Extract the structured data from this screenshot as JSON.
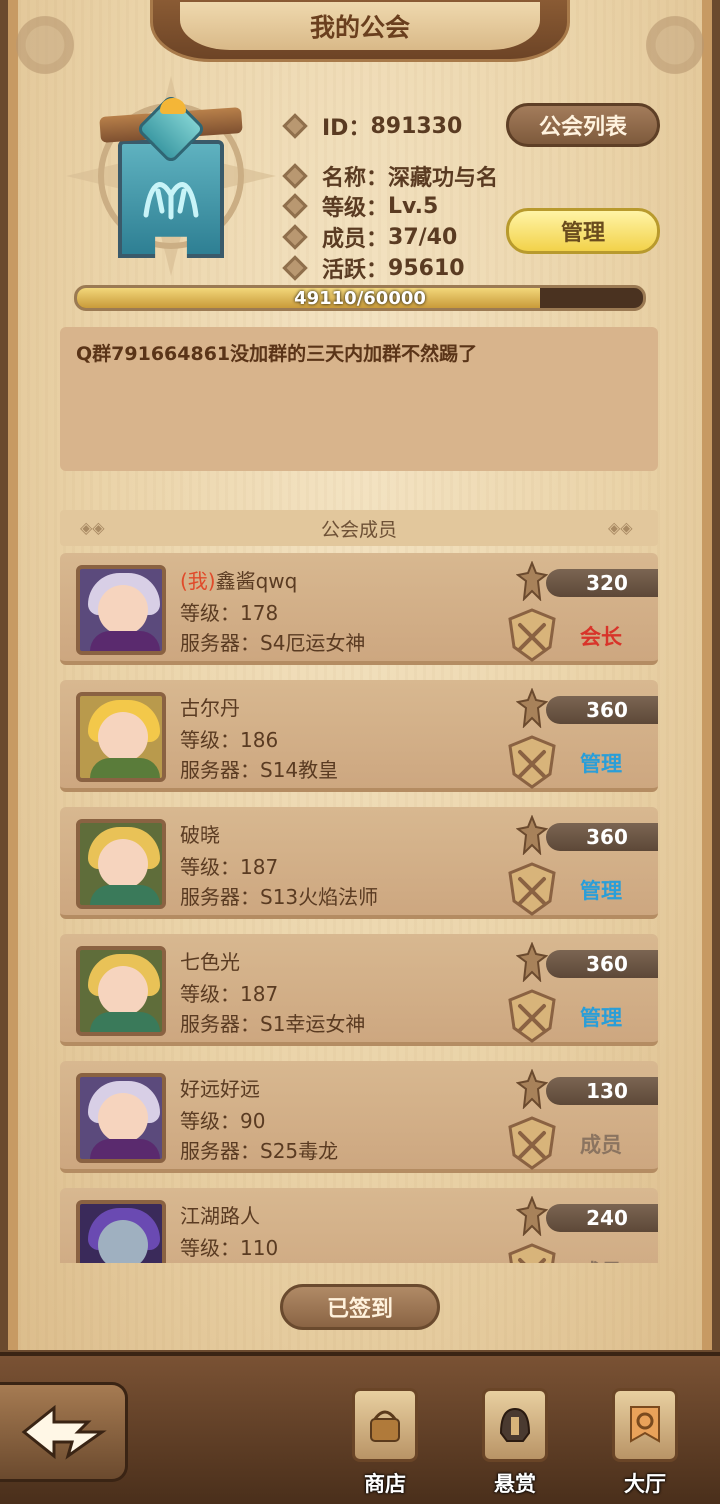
{
  "header": {
    "title": "我的公会"
  },
  "guild": {
    "id_label": "ID：",
    "id_value": "891330",
    "name_label": "名称：",
    "name_value": "深藏功与名",
    "level_label": "等级：",
    "level_value": "Lv.5",
    "members_label": "成员：",
    "members_value": "37/40",
    "activity_label": "活跃：",
    "activity_value": "95610",
    "guild_list_button": "公会列表",
    "manage_button": "管理",
    "exp_text": "49110/60000",
    "exp_fraction": 0.8185,
    "notice": "Q群791664861没加群的三天内加群不然踢了"
  },
  "members_section": {
    "title": "公会成员",
    "rows": [
      {
        "prefix": "(我)",
        "name": "鑫酱qwq",
        "level": "等级：178",
        "server": "服务器：S4厄运女神",
        "score": "320",
        "role": "会长",
        "role_type": "leader",
        "avatar": "avatar-purple-hair"
      },
      {
        "prefix": "",
        "name": "古尔丹",
        "level": "等级：186",
        "server": "服务器：S14教皇",
        "score": "360",
        "role": "管理",
        "role_type": "admin",
        "avatar": "avatar-blonde-girl"
      },
      {
        "prefix": "",
        "name": "破晓",
        "level": "等级：187",
        "server": "服务器：S13火焰法师",
        "score": "360",
        "role": "管理",
        "role_type": "admin",
        "avatar": "avatar-elf"
      },
      {
        "prefix": "",
        "name": "七色光",
        "level": "等级：187",
        "server": "服务器：S1幸运女神",
        "score": "360",
        "role": "管理",
        "role_type": "admin",
        "avatar": "avatar-elf"
      },
      {
        "prefix": "",
        "name": "好远好远",
        "level": "等级：90",
        "server": "服务器：S25毒龙",
        "score": "130",
        "role": "成员",
        "role_type": "member",
        "avatar": "avatar-purple-hair"
      },
      {
        "prefix": "",
        "name": "江湖路人",
        "level": "等级：110",
        "server": "",
        "score": "240",
        "role": "成员",
        "role_type": "member",
        "avatar": "avatar-dark"
      }
    ]
  },
  "sign_in_button": "已签到",
  "nav": {
    "shop": "商店",
    "bounty": "悬赏",
    "hall": "大厅"
  },
  "colors": {
    "leader": "#d8342a",
    "admin": "#2a9ed8",
    "member": "#8b7460"
  }
}
